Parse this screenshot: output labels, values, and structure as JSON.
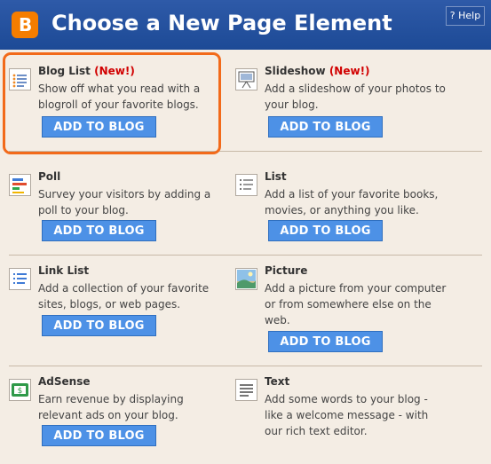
{
  "header": {
    "title": "Choose a New Page Element",
    "logo_letter": "B",
    "help_label": "? Help"
  },
  "items": [
    {
      "name": "Blog List",
      "badge": "(New!)",
      "description": "Show off what you read with a blogroll of your favorite blogs.",
      "button": "ADD TO BLOG",
      "icon": "blog-list-icon"
    },
    {
      "name": "Slideshow",
      "badge": "(New!)",
      "description": "Add a slideshow of your photos to your blog.",
      "button": "ADD TO BLOG",
      "icon": "slideshow-icon"
    },
    {
      "name": "Poll",
      "description": "Survey your visitors by adding a poll to your blog.",
      "button": "ADD TO BLOG",
      "icon": "poll-icon"
    },
    {
      "name": "List",
      "description": "Add a list of your favorite books, movies, or anything you like.",
      "button": "ADD TO BLOG",
      "icon": "list-icon"
    },
    {
      "name": "Link List",
      "description": "Add a collection of your favorite sites, blogs, or web pages.",
      "button": "ADD TO BLOG",
      "icon": "link-list-icon"
    },
    {
      "name": "Picture",
      "description": "Add a picture from your computer or from somewhere else on the web.",
      "button": "ADD TO BLOG",
      "icon": "picture-icon"
    },
    {
      "name": "AdSense",
      "description": "Earn revenue by displaying relevant ads on your blog.",
      "button": "ADD TO BLOG",
      "icon": "adsense-icon"
    },
    {
      "name": "Text",
      "description": "Add some words to your blog - like a welcome message - with our rich text editor.",
      "button": "",
      "icon": "text-icon"
    }
  ],
  "colors": {
    "header_blue": "#2e5aa8",
    "logo_orange": "#f57d00",
    "button_blue": "#4d91e6",
    "highlight_orange": "#f26a1a",
    "new_red": "#d10000",
    "background": "#f4ede4"
  }
}
